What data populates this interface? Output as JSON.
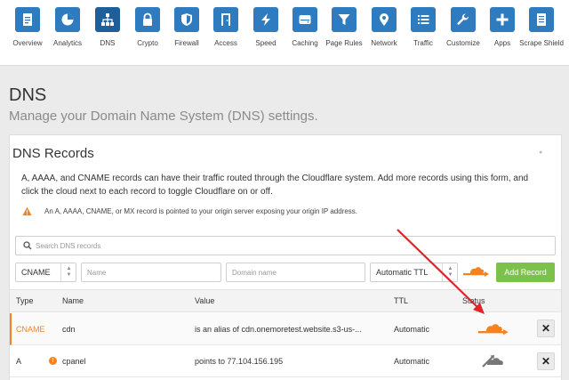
{
  "nav": [
    {
      "label": "Overview",
      "icon": "document-icon"
    },
    {
      "label": "Analytics",
      "icon": "pie-chart-icon"
    },
    {
      "label": "DNS",
      "icon": "network-tree-icon",
      "active": true
    },
    {
      "label": "Crypto",
      "icon": "lock-icon"
    },
    {
      "label": "Firewall",
      "icon": "shield-icon"
    },
    {
      "label": "Access",
      "icon": "door-icon"
    },
    {
      "label": "Speed",
      "icon": "lightning-icon"
    },
    {
      "label": "Caching",
      "icon": "hard-drive-icon"
    },
    {
      "label": "Page Rules",
      "icon": "filter-icon"
    },
    {
      "label": "Network",
      "icon": "location-pin-icon"
    },
    {
      "label": "Traffic",
      "icon": "list-icon"
    },
    {
      "label": "Customize",
      "icon": "wrench-icon"
    },
    {
      "label": "Apps",
      "icon": "plus-icon"
    },
    {
      "label": "Scrape Shield",
      "icon": "document-shield-icon"
    }
  ],
  "header": {
    "title": "DNS",
    "subtitle": "Manage your Domain Name System (DNS) settings."
  },
  "card": {
    "title": "DNS Records",
    "description": "A, AAAA, and CNAME records can have their traffic routed through the Cloudflare system. Add more records using this form, and click the cloud next to each record to toggle Cloudflare on or off.",
    "warning": "An A, AAAA, CNAME, or MX record is pointed to your origin server exposing your origin IP address."
  },
  "search": {
    "placeholder": "Search DNS records"
  },
  "form": {
    "type_value": "CNAME",
    "name_placeholder": "Name",
    "domain_placeholder": "Domain name",
    "ttl_value": "Automatic TTL",
    "add_label": "Add Record"
  },
  "table": {
    "headers": {
      "type": "Type",
      "name": "Name",
      "value": "Value",
      "ttl": "TTL",
      "status": "Status"
    },
    "rows": [
      {
        "type": "CNAME",
        "name": "cdn",
        "value_prefix": "is an alias of",
        "value": "cdn.onemoretest.website.s3-us-...",
        "ttl": "Automatic",
        "status": "proxied",
        "warning": false
      },
      {
        "type": "A",
        "name": "cpanel",
        "value_prefix": "points to",
        "value": "77.104.156.195",
        "ttl": "Automatic",
        "status": "dns-only",
        "warning": true
      }
    ]
  },
  "colors": {
    "nav_tile": "#2f7bbf",
    "cloudflare_orange": "#f6821f",
    "add_button": "#7cc24a",
    "annotation_arrow": "#e0252a"
  }
}
